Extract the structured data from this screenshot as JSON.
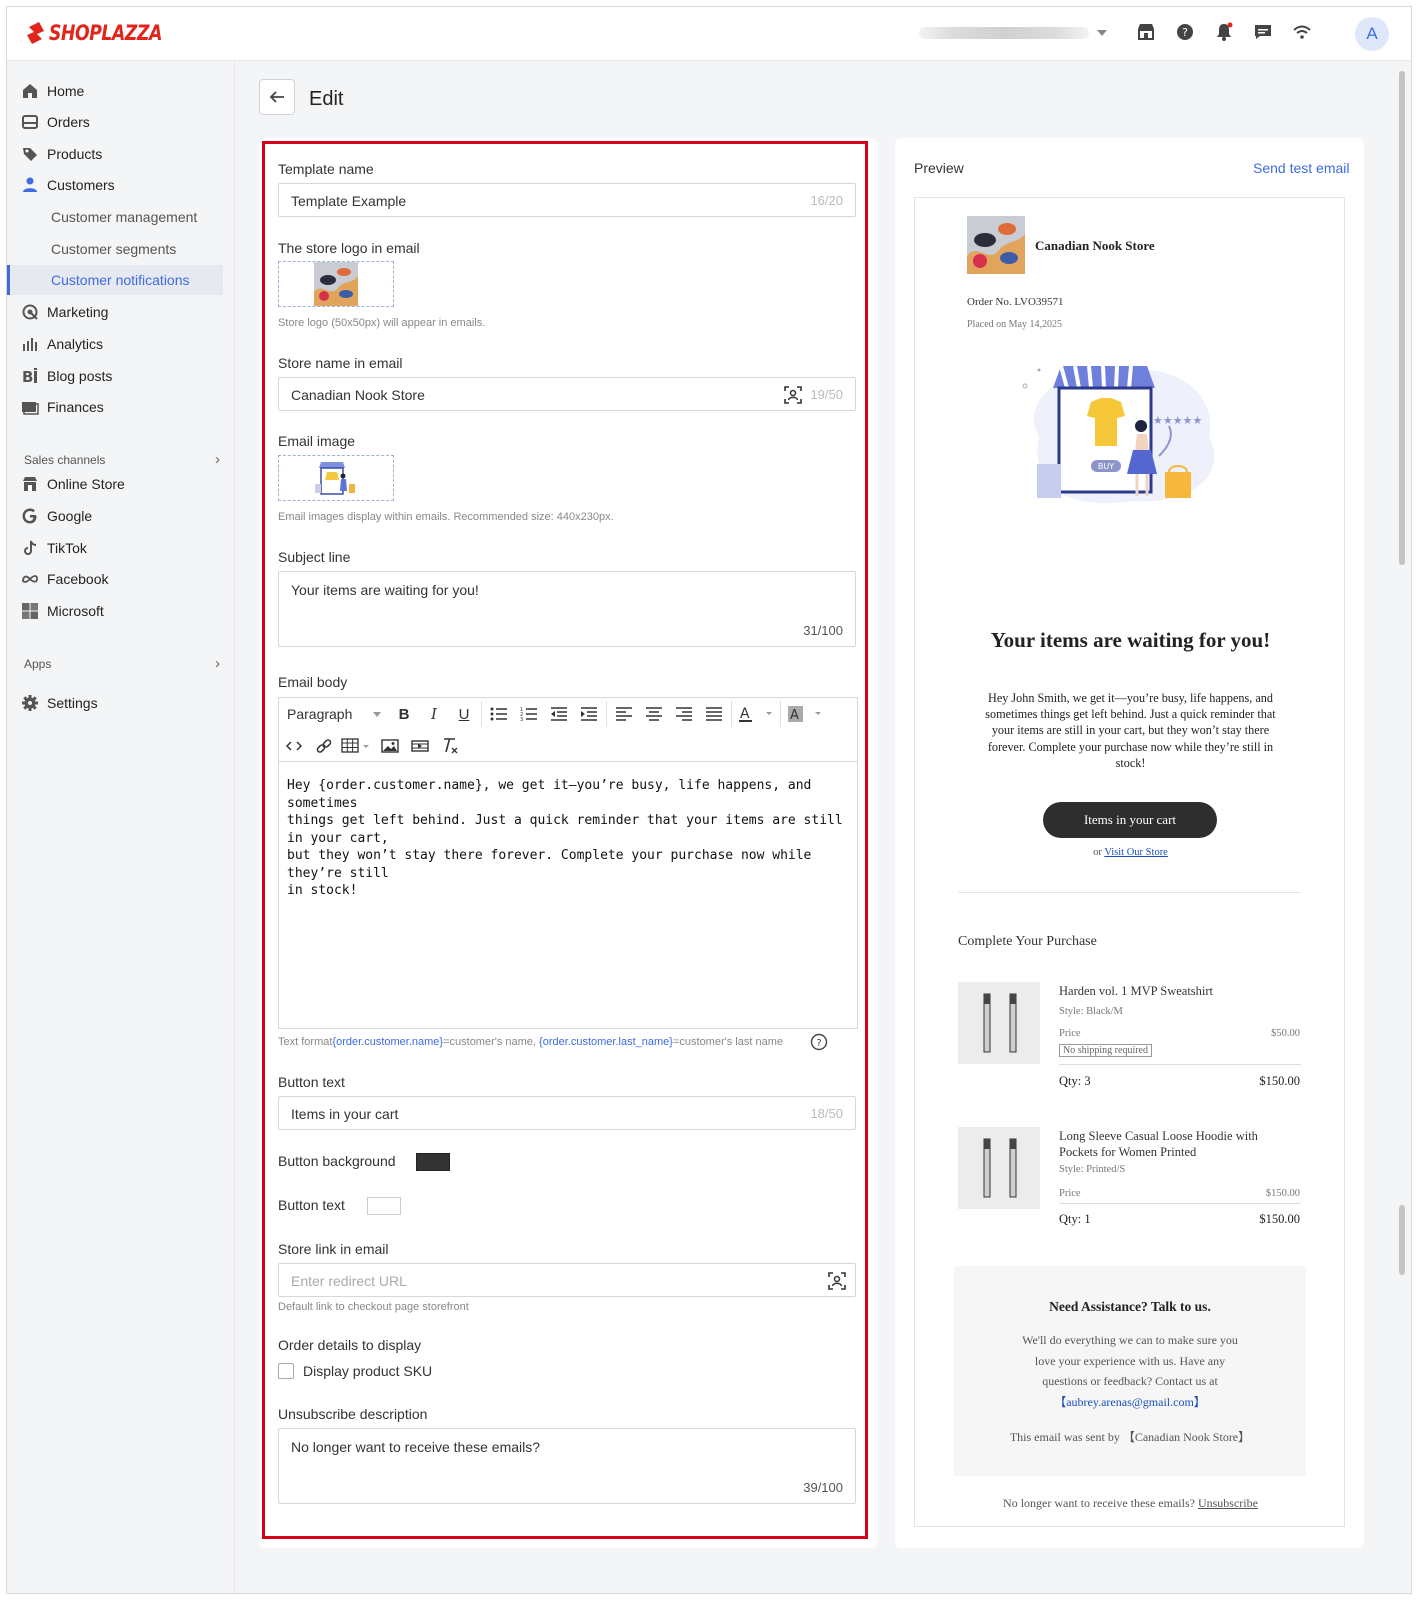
{
  "app": {
    "brand": "SHOPLAZZA",
    "avatar_letter": "A"
  },
  "topbar": {
    "icons": [
      "store-icon",
      "help-icon",
      "bell-icon",
      "chat-icon",
      "wifi-icon"
    ]
  },
  "sidebar": {
    "items": [
      {
        "label": "Home",
        "icon": "home-icon"
      },
      {
        "label": "Orders",
        "icon": "orders-icon"
      },
      {
        "label": "Products",
        "icon": "tag-icon"
      },
      {
        "label": "Customers",
        "icon": "person-icon"
      },
      {
        "label": "Customer management"
      },
      {
        "label": "Customer segments"
      },
      {
        "label": "Customer notifications"
      },
      {
        "label": "Marketing",
        "icon": "marketing-icon"
      },
      {
        "label": "Analytics",
        "icon": "analytics-icon"
      },
      {
        "label": "Blog posts",
        "icon": "blog-icon"
      },
      {
        "label": "Finances",
        "icon": "finances-icon"
      }
    ],
    "sales_channels_label": "Sales channels",
    "channels": [
      {
        "label": "Online Store",
        "icon": "store-icon"
      },
      {
        "label": "Google",
        "icon": "google-icon"
      },
      {
        "label": "TikTok",
        "icon": "tiktok-icon"
      },
      {
        "label": "Facebook",
        "icon": "meta-icon"
      },
      {
        "label": "Microsoft",
        "icon": "microsoft-icon"
      }
    ],
    "apps_label": "Apps",
    "settings_label": "Settings"
  },
  "page": {
    "title": "Edit"
  },
  "form": {
    "template_name_label": "Template name",
    "template_name_value": "Template Example",
    "template_name_count": "16/20",
    "logo_label": "The store logo in email",
    "logo_hint": "Store logo (50x50px) will appear in emails.",
    "store_name_label": "Store name in email",
    "store_name_value": "Canadian Nook Store",
    "store_name_count": "19/50",
    "email_image_label": "Email image",
    "email_image_hint": "Email images display within emails. Recommended size: 440x230px.",
    "subject_label": "Subject line",
    "subject_value": "Your items are waiting for you!",
    "subject_count": "31/100",
    "body_label": "Email body",
    "paragraph_select": "Paragraph",
    "body_lines": [
      "Hey {order.customer.name}, we get it—you’re busy, life happens, and sometimes",
      "things get left behind. Just a quick reminder that your items are still in your cart,",
      "but they won’t stay there forever. Complete your purchase now while they’re still",
      "in stock!"
    ],
    "format_hint_prefix": "Text format",
    "format_var1": "{order.customer.name}",
    "format_mid": "=customer's name, ",
    "format_var2": "{order.customer.last_name}",
    "format_suffix": "=customer's last name",
    "button_text_label": "Button text",
    "button_text_value": "Items in your cart",
    "button_text_count": "18/50",
    "button_bg_label": "Button background",
    "button_bg_color": "#333333",
    "button_text_color_label": "Button text",
    "button_text_color": "#ffffff",
    "store_link_label": "Store link in email",
    "store_link_placeholder": "Enter redirect URL",
    "store_link_hint": "Default link to checkout page storefront",
    "order_details_label": "Order details to display",
    "display_sku_label": "Display product SKU",
    "display_sku_checked": false,
    "unsubscribe_label": "Unsubscribe description",
    "unsubscribe_value": "No longer want to receive these emails?",
    "unsubscribe_count": "39/100"
  },
  "preview": {
    "title": "Preview",
    "send_test": "Send test email",
    "store_name": "Canadian Nook Store",
    "order_no": "Order No. LVO39571",
    "placed_on": "Placed on May 14,2025",
    "buy_label": "BUY",
    "heading": "Your items are waiting for you!",
    "body_lines": [
      "Hey John Smith, we get it—you’re busy, life happens, and",
      "sometimes things get left behind. Just a quick reminder that",
      "your items are still in your cart, but they won’t stay there",
      "forever. Complete your purchase now while they’re still in",
      "stock!"
    ],
    "button": "Items in your cart",
    "or_text": "or ",
    "visit_store": "Visit Our Store",
    "complete_title": "Complete Your Purchase",
    "products": [
      {
        "name_lines": [
          "Harden vol. 1 MVP Sweatshirt"
        ],
        "style": "Style: Black/M",
        "price_label": "Price",
        "price": "$50.00",
        "badge": "No shipping required",
        "qty": "Qty: 3",
        "total": "$150.00"
      },
      {
        "name_lines": [
          "Long Sleeve Casual Loose Hoodie with",
          "Pockets for Women Printed"
        ],
        "style": "Style: Printed/S",
        "price_label": "Price",
        "price": "$150.00",
        "qty": "Qty: 1",
        "total": "$150.00"
      }
    ],
    "assist_title": "Need Assistance? Talk to us.",
    "assist_lines": [
      "We'll do everything we can to make sure you",
      "love your experience with us. Have any",
      "questions or feedback? Contact us at"
    ],
    "assist_email": "【aubrey.arenas@gmail.com】",
    "sent_by": "This email was sent by 【Canadian Nook Store】",
    "unsub_text": "No longer want to receive these emails? ",
    "unsub_link": "Unsubscribe"
  },
  "colors": {
    "accent": "#3f6be0",
    "brand": "#e1251b",
    "highlight_border": "#d9001b"
  }
}
